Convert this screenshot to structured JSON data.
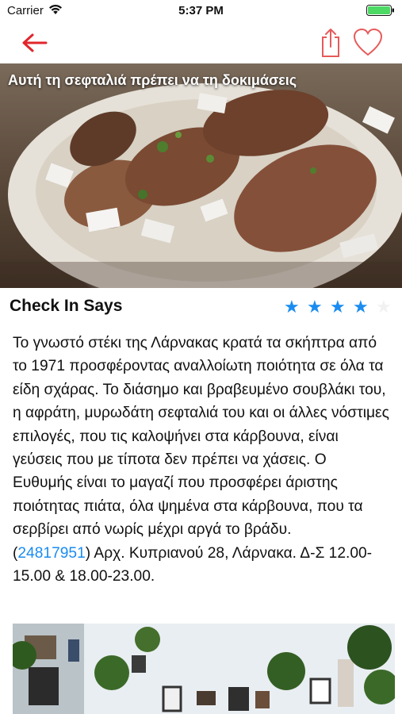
{
  "status_bar": {
    "carrier": "Carrier",
    "time": "5:37 PM"
  },
  "nav": {
    "back_icon": "back-arrow-icon",
    "share_icon": "share-icon",
    "favorite_icon": "heart-icon",
    "accent_color": "#e0262c"
  },
  "hero": {
    "title": "Αυτή τη σεφταλιά πρέπει να τη δοκιμάσεις"
  },
  "section": {
    "title": "Check In Says",
    "rating": 4,
    "rating_max": 5,
    "star_color": "#1a8cf0"
  },
  "article": {
    "body": "Το γνωστό στέκι της Λάρνακας κρατά τα σκήπτρα από το 1971 προσφέροντας αναλλοίωτη ποιότητα σε όλα τα είδη σχάρας. Το διάσημο και βραβευμένο σουβλάκι του, η αφράτη, μυρωδάτη σεφταλιά του και οι άλλες νόστιμες επιλογές, που τις καλοψήνει στα κάρβουνα, είναι γεύσεις που με τίποτα δεν πρέπει να χάσεις. Ο Ευθυμής είναι το μαγαζί που προσφέρει άριστης ποιότητας πιάτα, όλα ψημένα στα κάρβουνα, που τα σερβίρει από νωρίς μέχρι αργά το βράδυ.",
    "paren_open": "(",
    "phone": "24817951",
    "address": ") Αρχ. Κυπριανού 28, Λάρνακα. Δ-Σ 12.00-15.00 & 18.00-23.00."
  }
}
